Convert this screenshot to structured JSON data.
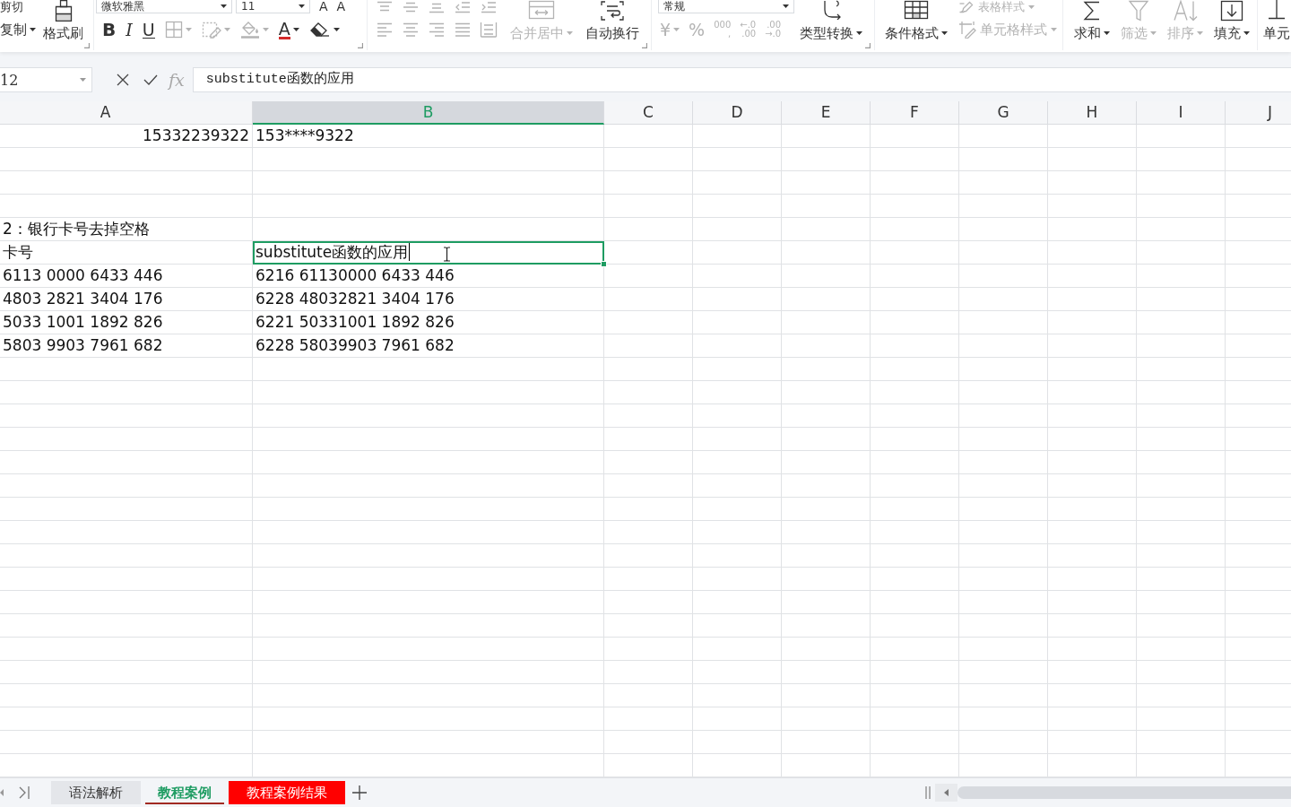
{
  "ribbon": [
    {
      "launcher": true,
      "columns": [
        {
          "kind": "stack",
          "rows": [
            {
              "items": [
                {
                  "kind": "text",
                  "label": "剪切",
                  "disabled": false
                }
              ]
            },
            {
              "items": [
                {
                  "kind": "text",
                  "label": "复制",
                  "dropdown": true,
                  "disabled": false
                }
              ]
            }
          ]
        },
        {
          "kind": "large",
          "label": "格式刷",
          "disabled": false
        }
      ]
    },
    {
      "launcher": true,
      "columns": [
        {
          "kind": "stack",
          "rows": [
            {
              "items": [
                {
                  "kind": "field",
                  "value": "微软雅黑"
                },
                {
                  "kind": "combo",
                  "value": "11"
                },
                {
                  "kind": "glyph",
                  "label": "A",
                  "disabled": false
                },
                {
                  "kind": "glyph",
                  "label": "A",
                  "disabled": false
                }
              ]
            },
            {
              "items": [
                {
                  "kind": "bold",
                  "label": "B",
                  "disabled": false
                },
                {
                  "kind": "italic",
                  "label": "I",
                  "disabled": false
                },
                {
                  "kind": "underline",
                  "label": "U",
                  "disabled": false
                },
                {
                  "kind": "icon",
                  "dropdown": true,
                  "disabled": true
                },
                {
                  "kind": "icon",
                  "dropdown": true,
                  "disabled": true
                },
                {
                  "kind": "icon",
                  "dropdown": true,
                  "disabled": true
                },
                {
                  "kind": "fontcolor",
                  "label": "A",
                  "dropdown": true,
                  "disabled": false
                },
                {
                  "kind": "icon",
                  "dropdown": true,
                  "disabled": false
                }
              ]
            }
          ]
        }
      ]
    },
    {
      "launcher": true,
      "columns": [
        {
          "kind": "stack",
          "rows": [
            {
              "items": [
                {
                  "kind": "icon",
                  "disabled": true
                },
                {
                  "kind": "icon",
                  "disabled": true
                },
                {
                  "kind": "icon",
                  "disabled": true
                },
                {
                  "kind": "icon",
                  "disabled": true
                },
                {
                  "kind": "icon",
                  "disabled": true
                }
              ]
            },
            {
              "items": [
                {
                  "kind": "icon",
                  "disabled": true
                },
                {
                  "kind": "icon",
                  "disabled": true
                },
                {
                  "kind": "icon",
                  "disabled": true
                },
                {
                  "kind": "icon",
                  "disabled": true
                },
                {
                  "kind": "icon",
                  "disabled": true
                }
              ]
            }
          ]
        },
        {
          "kind": "large",
          "label": "合并居中",
          "dropdown": true,
          "disabled": true
        },
        {
          "kind": "large",
          "label": "自动换行",
          "disabled": false
        }
      ]
    },
    {
      "launcher": true,
      "columns": [
        {
          "kind": "stack",
          "rows": [
            {
              "items": [
                {
                  "kind": "field",
                  "value": "常规"
                }
              ]
            },
            {
              "items": [
                {
                  "kind": "glyph",
                  "label": "¥",
                  "dropdown": true,
                  "disabled": true
                },
                {
                  "kind": "glyph",
                  "label": "%",
                  "disabled": true
                },
                {
                  "kind": "lines",
                  "lines": [
                    "000",
                    ","
                  ],
                  "disabled": true
                },
                {
                  "kind": "lines",
                  "lines": [
                    "←.0",
                    ".00"
                  ],
                  "disabled": true
                },
                {
                  "kind": "lines",
                  "lines": [
                    ".00",
                    "→.0"
                  ],
                  "disabled": true
                }
              ]
            }
          ]
        },
        {
          "kind": "large",
          "label": "类型转换",
          "dropdown": true,
          "disabled": false
        }
      ]
    },
    {
      "columns": [
        {
          "kind": "large",
          "label": "条件格式",
          "dropdown": true,
          "disabled": false
        },
        {
          "kind": "stack",
          "rows": [
            {
              "items": [
                {
                  "kind": "icontext",
                  "label": "表格样式",
                  "dropdown": true,
                  "disabled": true
                }
              ]
            },
            {
              "items": [
                {
                  "kind": "icontext",
                  "label": "单元格样式",
                  "dropdown": true,
                  "disabled": true
                }
              ]
            }
          ]
        }
      ]
    },
    {
      "columns": [
        {
          "kind": "large",
          "label": "求和",
          "dropdown": true,
          "disabled": false
        },
        {
          "kind": "large",
          "label": "筛选",
          "dropdown": true,
          "disabled": true
        },
        {
          "kind": "large",
          "label": "排序",
          "dropdown": true,
          "disabled": true
        },
        {
          "kind": "large",
          "label": "填充",
          "dropdown": true,
          "disabled": false
        }
      ]
    },
    {
      "columns": [
        {
          "kind": "large",
          "label": "单元",
          "disabled": false
        }
      ]
    }
  ],
  "formula_bar": {
    "name_box": "12",
    "fx": "fx",
    "formula": "substitute函数的应用"
  },
  "columns": [
    {
      "label": "A",
      "selected": false
    },
    {
      "label": "B",
      "selected": true
    },
    {
      "label": "C",
      "selected": false
    },
    {
      "label": "D",
      "selected": false
    },
    {
      "label": "E",
      "selected": false
    },
    {
      "label": "F",
      "selected": false
    },
    {
      "label": "G",
      "selected": false
    },
    {
      "label": "H",
      "selected": false
    },
    {
      "label": "I",
      "selected": false
    },
    {
      "label": "J",
      "selected": false
    }
  ],
  "rows": [
    {
      "cells": [
        {
          "kind": "number",
          "text": "15332239322",
          "editing": false
        },
        {
          "kind": "text",
          "text": "153****9322",
          "editing": false
        }
      ]
    },
    {},
    {},
    {},
    {
      "cells": [
        {
          "kind": "text",
          "text": "2：银行卡号去掉空格",
          "editing": false
        }
      ]
    },
    {
      "cells": [
        {
          "kind": "text",
          "text": "卡号",
          "editing": false
        },
        {
          "kind": "text",
          "text": "substitute函数的应用",
          "editing": true
        }
      ]
    },
    {
      "cells": [
        {
          "kind": "text",
          "text": "6113 0000 6433 446",
          "editing": false
        },
        {
          "kind": "text",
          "text": "6216 61130000 6433 446",
          "editing": false
        }
      ]
    },
    {
      "cells": [
        {
          "kind": "text",
          "text": "4803 2821 3404 176",
          "editing": false
        },
        {
          "kind": "text",
          "text": "6228 48032821 3404 176",
          "editing": false
        }
      ]
    },
    {
      "cells": [
        {
          "kind": "text",
          "text": "5033 1001 1892 826",
          "editing": false
        },
        {
          "kind": "text",
          "text": "6221 50331001 1892 826",
          "editing": false
        }
      ]
    },
    {
      "cells": [
        {
          "kind": "text",
          "text": "5803 9903 7961 682",
          "editing": false
        },
        {
          "kind": "text",
          "text": "6228 58039903 7961 682",
          "editing": false
        }
      ]
    }
  ],
  "sheet_tabs": [
    {
      "label": "语法解析",
      "selected": false
    },
    {
      "label": "教程案例",
      "selected": true
    },
    {
      "label": "教程案例结果",
      "selected": false,
      "color": "#ff0000"
    }
  ]
}
